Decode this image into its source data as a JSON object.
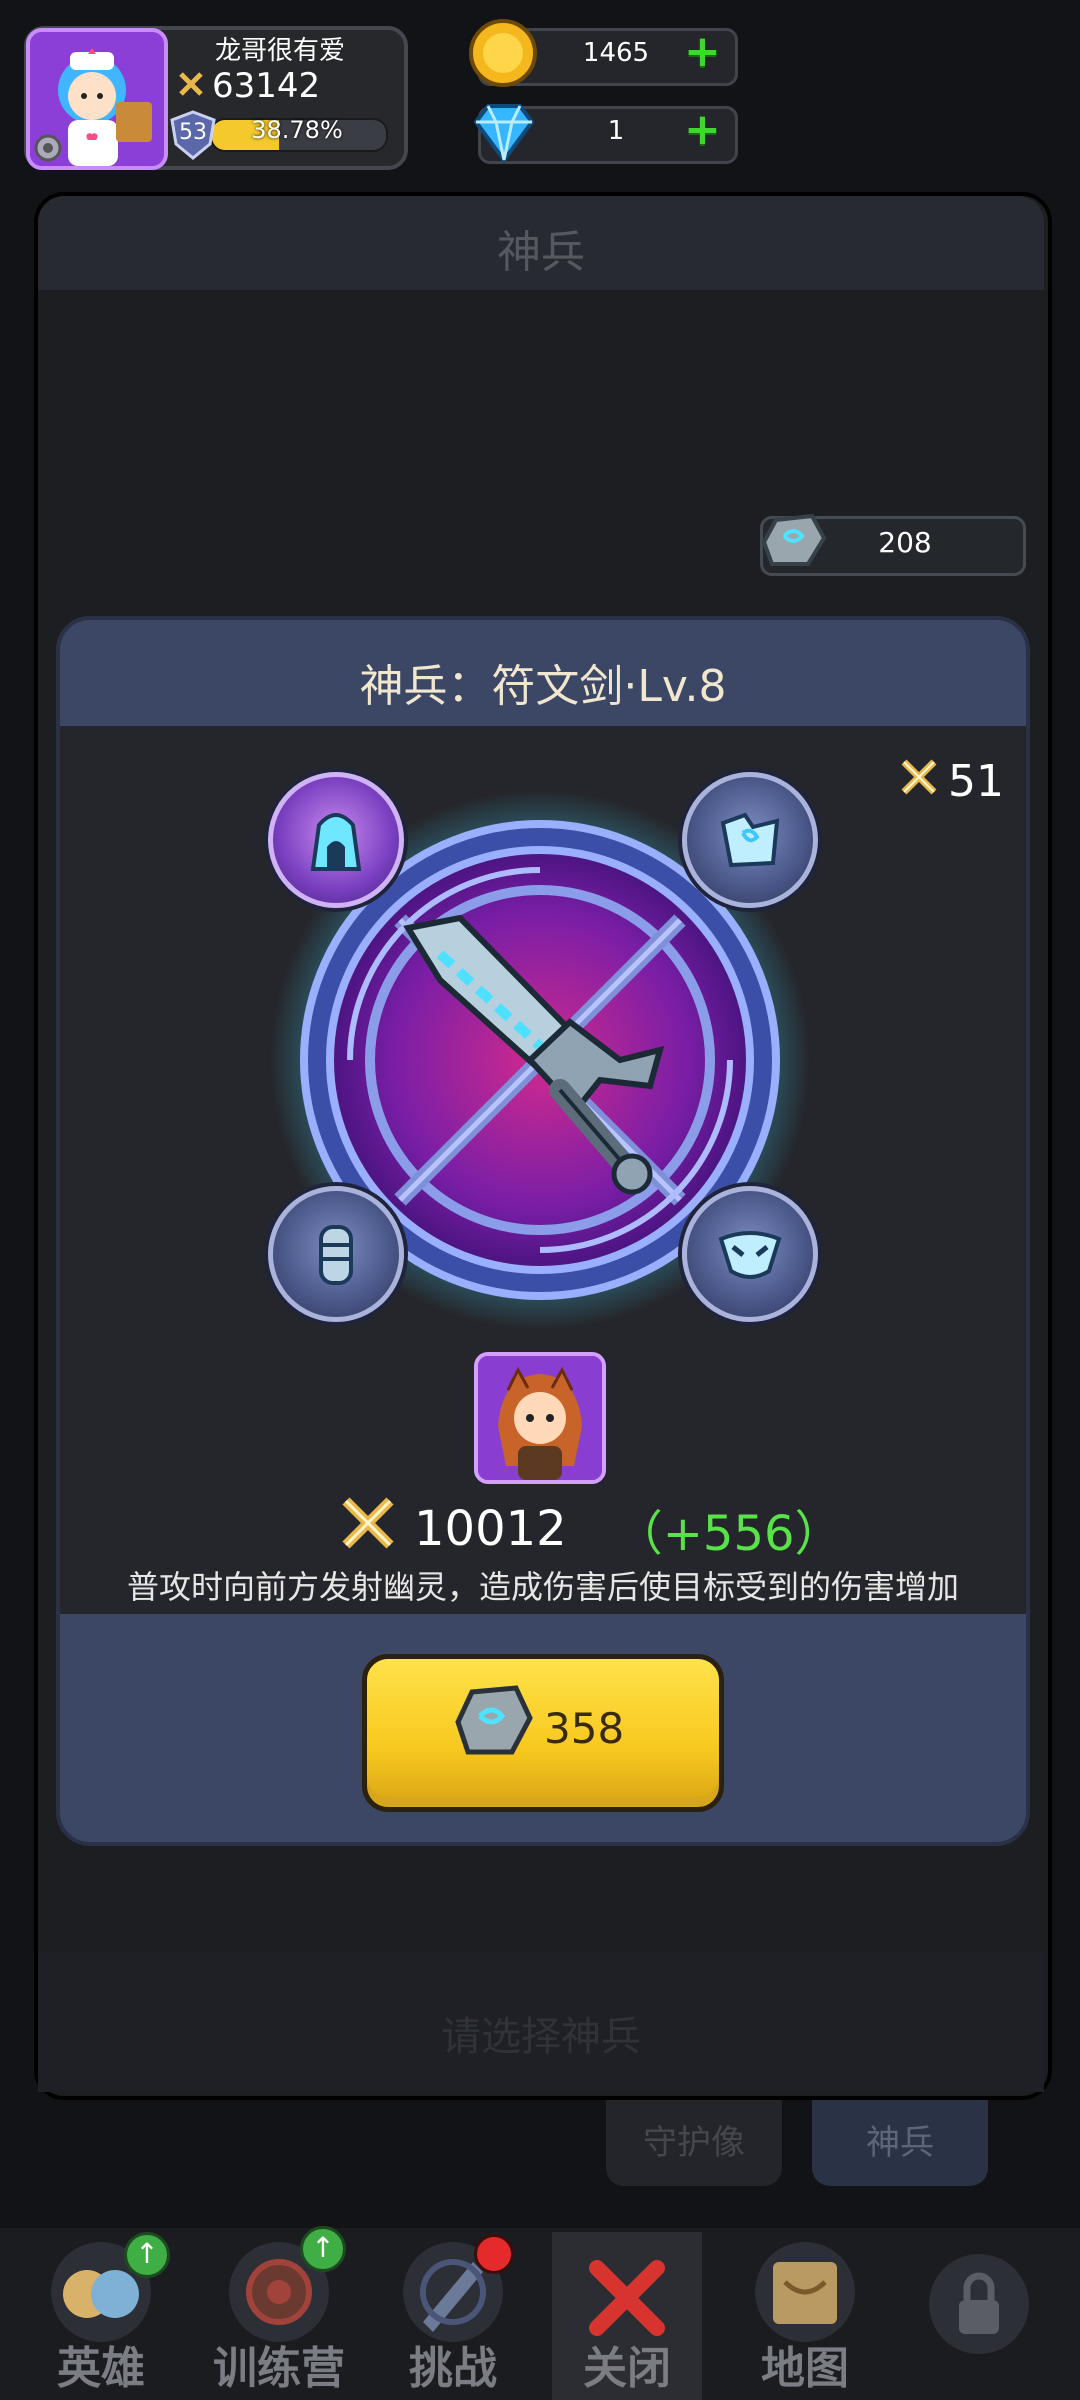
{
  "player": {
    "name": "龙哥很有爱",
    "power": "63142",
    "level": "53",
    "exp_percent_text": "38.78%",
    "exp_fraction": 0.3878
  },
  "currency": {
    "gold": "1465",
    "diamond": "1",
    "plus_symbol": "+"
  },
  "background_screen": {
    "title": "神兵",
    "rune_stone_count": "208",
    "hint": "请选择神兵",
    "tabs": [
      {
        "label": "守护像",
        "selected": false
      },
      {
        "label": "神兵",
        "selected": true
      }
    ]
  },
  "modal": {
    "title": "神兵：符文剑·Lv.8",
    "power": "51",
    "weapon_power": "10012",
    "power_bonus": "（+556）",
    "description": "普攻时向前方发射幽灵，造成伤害后使目标受到的伤害增加",
    "upgrade_cost": "358"
  },
  "nav": {
    "items": [
      {
        "label": "英雄",
        "icon": "heroes-icon",
        "badge": "upgrade"
      },
      {
        "label": "训练营",
        "icon": "training-camp-icon",
        "badge": "upgrade"
      },
      {
        "label": "挑战",
        "icon": "challenge-icon",
        "badge": "dot"
      },
      {
        "label": "关闭",
        "icon": "close-icon",
        "badge": null
      },
      {
        "label": "地图",
        "icon": "map-icon",
        "badge": null
      },
      {
        "label": "",
        "icon": "locked-icon",
        "badge": null
      }
    ]
  },
  "colors": {
    "accent_yellow": "#f8c91f",
    "bonus_green": "#5ae24b",
    "close_red": "#d8342f",
    "modal_blue": "#3c4766"
  }
}
